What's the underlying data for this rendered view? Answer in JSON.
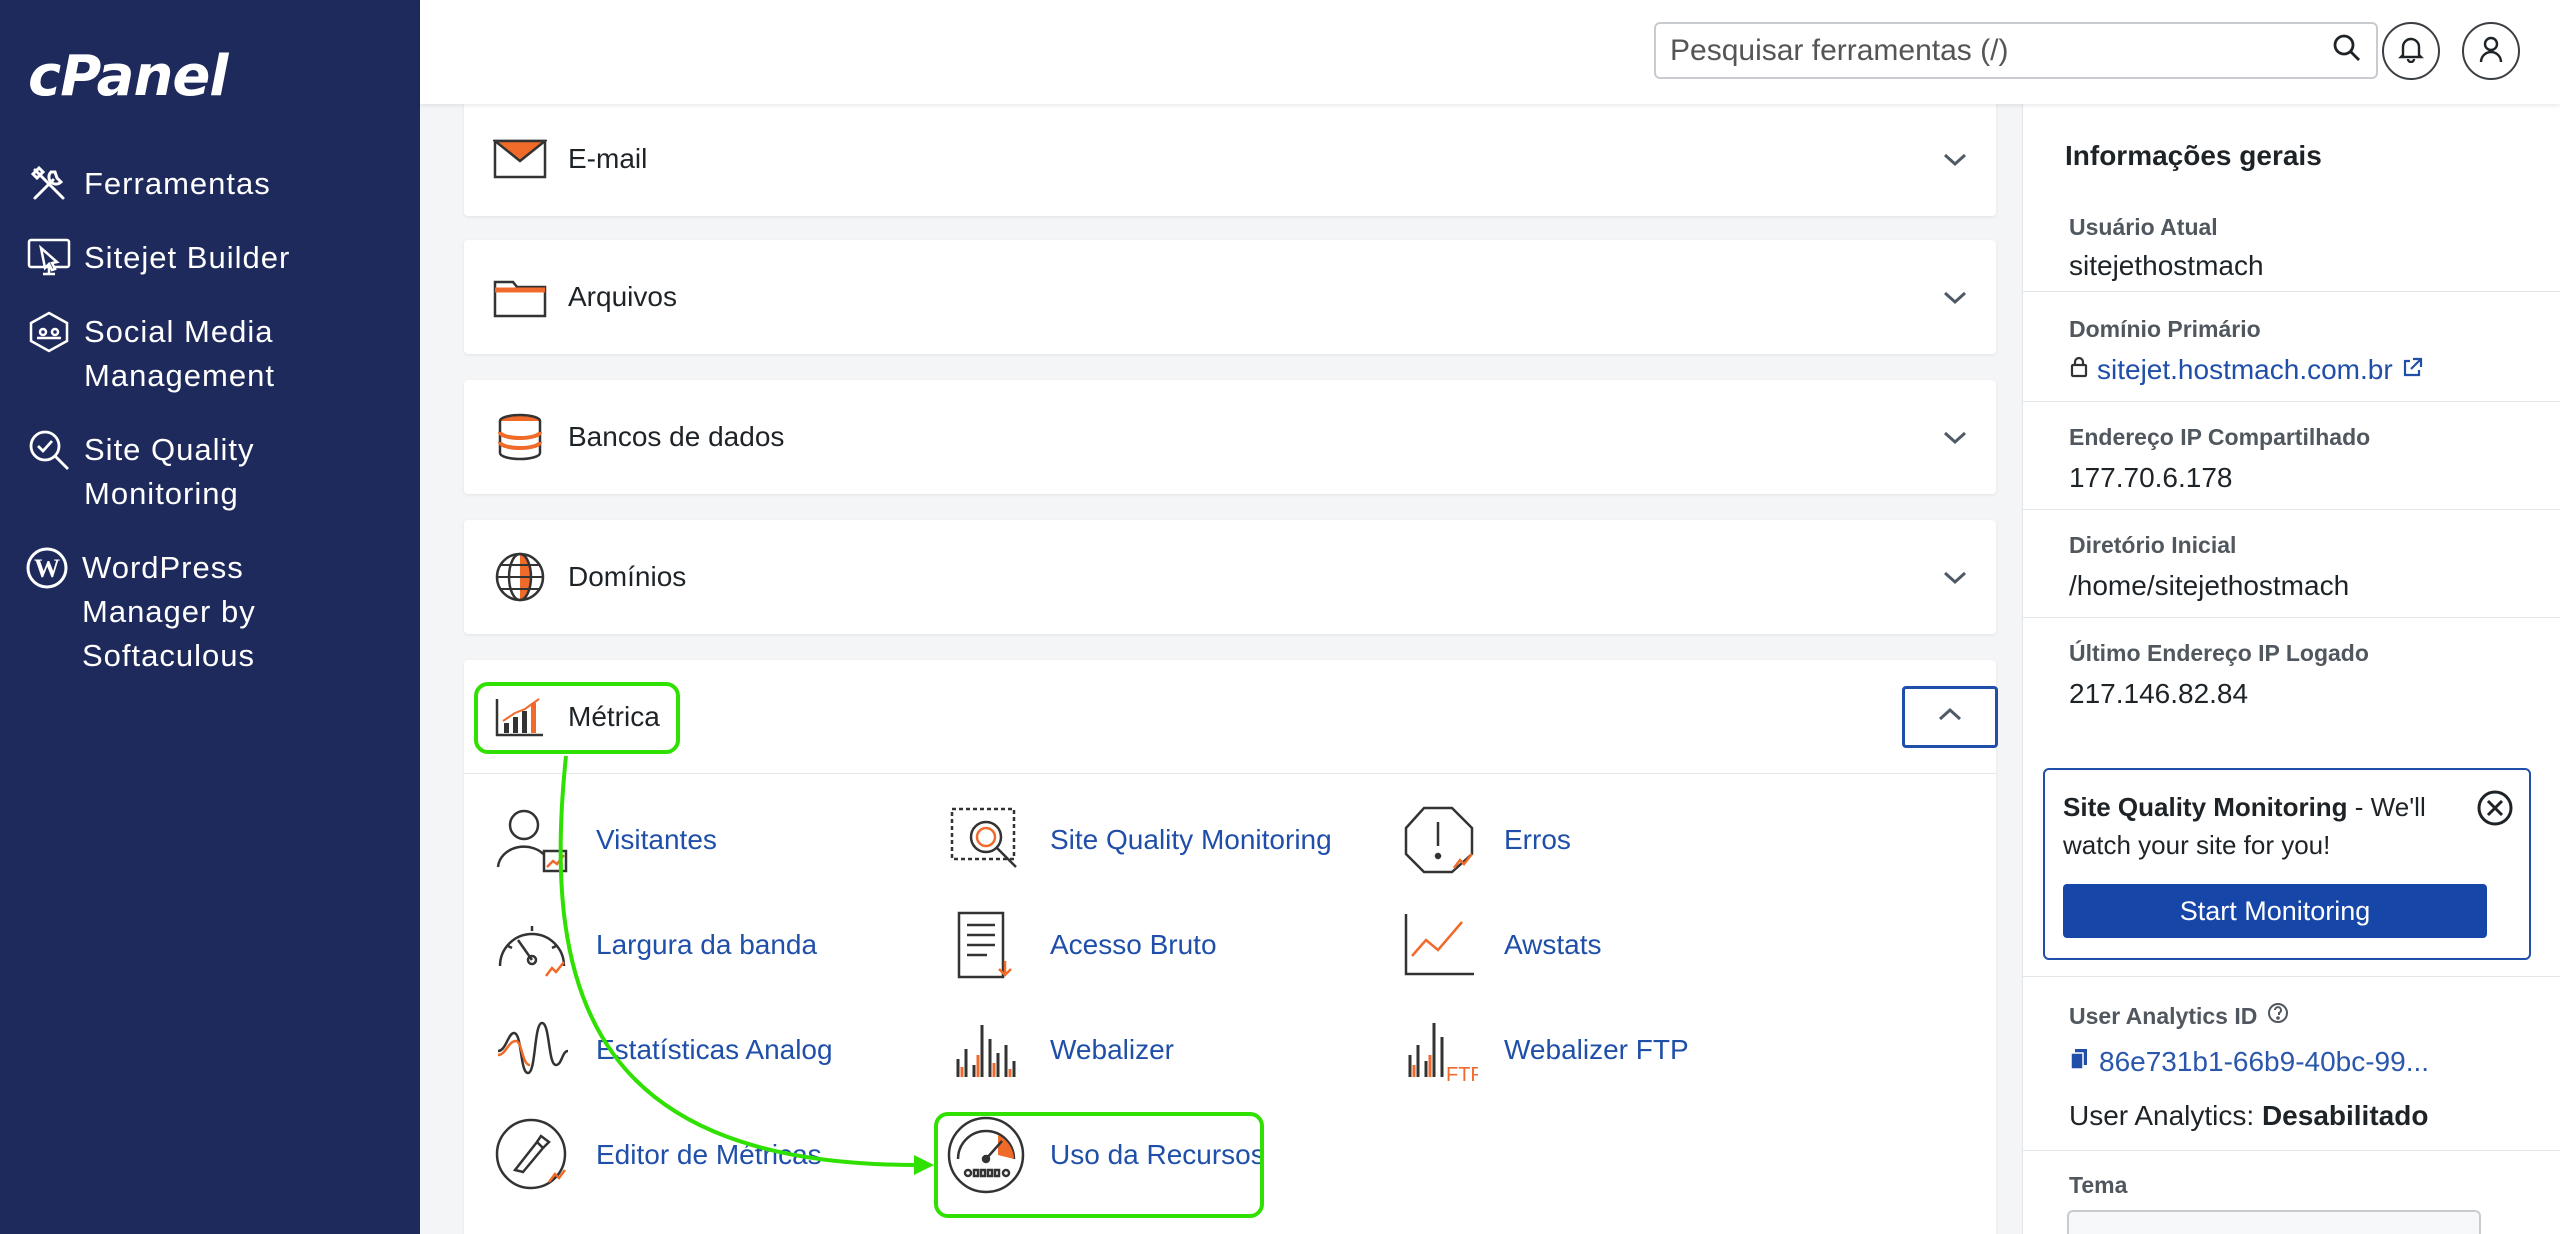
{
  "brand": {
    "logo": "cPanel"
  },
  "sidebar": {
    "items": [
      {
        "label": "Ferramentas"
      },
      {
        "label": "Sitejet Builder"
      },
      {
        "label": "Social Media Management"
      },
      {
        "label": "Site Quality Monitoring"
      },
      {
        "label": "WordPress Manager by Softaculous"
      }
    ]
  },
  "topbar": {
    "search_placeholder": "Pesquisar ferramentas (/)"
  },
  "sections": [
    {
      "title": "E-mail"
    },
    {
      "title": "Arquivos"
    },
    {
      "title": "Bancos de dados"
    },
    {
      "title": "Domínios"
    },
    {
      "title": "Métrica"
    }
  ],
  "metrics_tools": [
    {
      "label": "Visitantes"
    },
    {
      "label": "Site Quality Monitoring"
    },
    {
      "label": "Erros"
    },
    {
      "label": "Largura da banda"
    },
    {
      "label": "Acesso Bruto"
    },
    {
      "label": "Awstats"
    },
    {
      "label": "Estatísticas Analog"
    },
    {
      "label": "Webalizer"
    },
    {
      "label": "Webalizer FTP"
    },
    {
      "label": "Editor de Métricas"
    },
    {
      "label": "Uso da Recursos"
    }
  ],
  "general_info": {
    "title": "Informações gerais",
    "current_user_label": "Usuário Atual",
    "current_user": "sitejethostmach",
    "primary_domain_label": "Domínio Primário",
    "primary_domain": "sitejet.hostmach.com.br",
    "shared_ip_label": "Endereço IP Compartilhado",
    "shared_ip": "177.70.6.178",
    "home_dir_label": "Diretório Inicial",
    "home_dir": "/home/sitejethostmach",
    "last_ip_label": "Último Endereço IP Logado",
    "last_ip": "217.146.82.84",
    "analytics_id_label": "User Analytics ID",
    "analytics_id": "86e731b1-66b9-40bc-99...",
    "analytics_status_label": "User Analytics:",
    "analytics_status": "Desabilitado",
    "theme_label": "Tema"
  },
  "promo": {
    "title": "Site Quality Monitoring",
    "text": " - We'll watch your site for you!",
    "button": "Start Monitoring"
  },
  "colors": {
    "sidebar_bg": "#1f2a5c",
    "link": "#1f4fa8",
    "accent_orange": "#f06a2a",
    "highlight_green": "#2fe000",
    "primary_button": "#1646a8"
  }
}
